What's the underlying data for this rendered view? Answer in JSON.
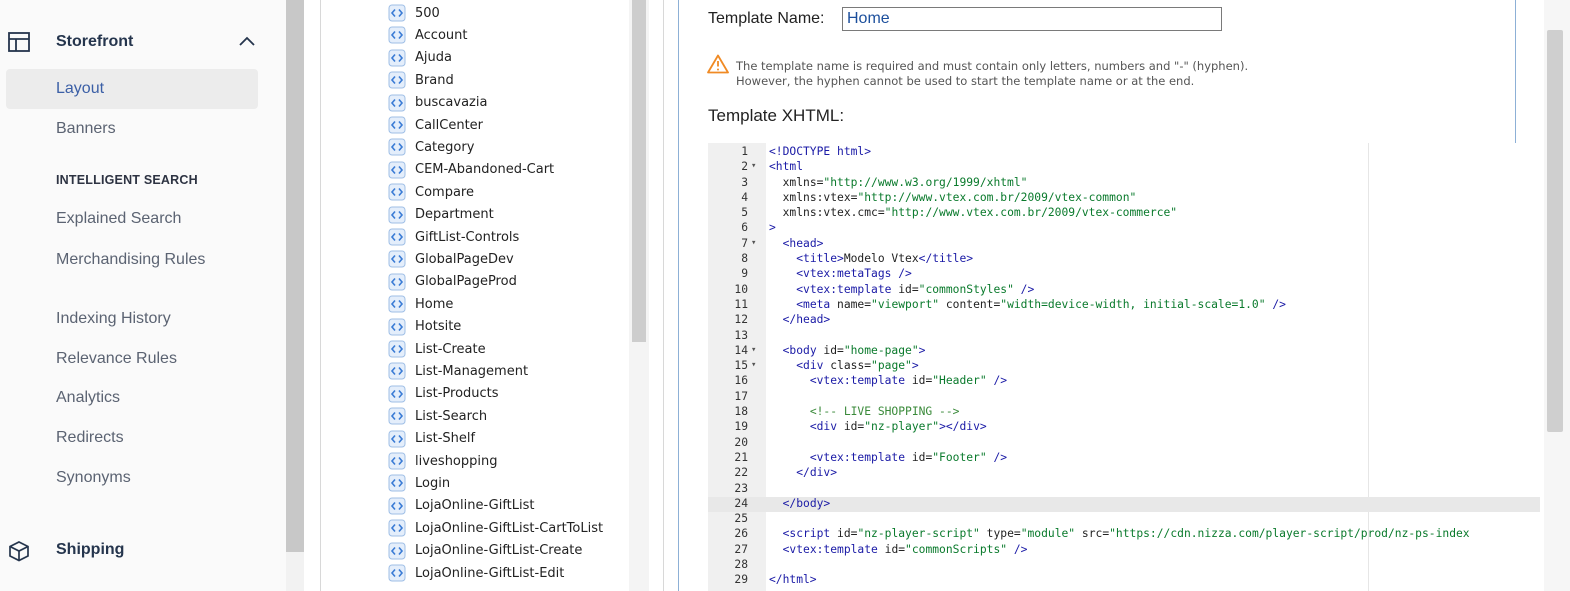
{
  "sidebar": {
    "storefront_label": "Storefront",
    "items": [
      {
        "label": "Layout"
      },
      {
        "label": "Banners"
      }
    ],
    "intelligent_search_heading": "INTELLIGENT SEARCH",
    "search_items": [
      {
        "label": "Explained Search"
      },
      {
        "label": "Merchandising Rules"
      },
      {
        "label": "Indexing History"
      },
      {
        "label": "Relevance Rules"
      },
      {
        "label": "Analytics"
      },
      {
        "label": "Redirects"
      },
      {
        "label": "Synonyms"
      }
    ],
    "shipping_label": "Shipping"
  },
  "templates": [
    "500",
    "Account",
    "Ajuda",
    "Brand",
    "buscavazia",
    "CallCenter",
    "Category",
    "CEM-Abandoned-Cart",
    "Compare",
    "Department",
    "GiftList-Controls",
    "GlobalPageDev",
    "GlobalPageProd",
    "Home",
    "Hotsite",
    "List-Create",
    "List-Management",
    "List-Products",
    "List-Search",
    "List-Shelf",
    "liveshopping",
    "Login",
    "LojaOnline-GiftList",
    "LojaOnline-GiftList-CartToList",
    "LojaOnline-GiftList-Create",
    "LojaOnline-GiftList-Edit"
  ],
  "editor": {
    "template_name_label": "Template Name:",
    "template_name_value": "Home",
    "warning_line1": "The template name is required and must contain only letters, numbers and \"-\" (hyphen).",
    "warning_line2": "However, the hyphen cannot be used to start the template name or at the end.",
    "xhtml_label": "Template XHTML:",
    "active_line": 24,
    "code": [
      {
        "n": "1",
        "f": "",
        "segs": [
          [
            "tag",
            "<!DOCTYPE html>"
          ]
        ]
      },
      {
        "n": "2",
        "f": "▾",
        "segs": [
          [
            "tag",
            "<html"
          ]
        ]
      },
      {
        "n": "3",
        "f": "",
        "segs": [
          [
            "txt",
            "  "
          ],
          [
            "attr",
            "xmlns="
          ],
          [
            "str",
            "\"http://www.w3.org/1999/xhtml\""
          ]
        ]
      },
      {
        "n": "4",
        "f": "",
        "segs": [
          [
            "txt",
            "  "
          ],
          [
            "attr",
            "xmlns:vtex="
          ],
          [
            "str",
            "\"http://www.vtex.com.br/2009/vtex-common\""
          ]
        ]
      },
      {
        "n": "5",
        "f": "",
        "segs": [
          [
            "txt",
            "  "
          ],
          [
            "attr",
            "xmlns:vtex.cmc="
          ],
          [
            "str",
            "\"http://www.vtex.com.br/2009/vtex-commerce\""
          ]
        ]
      },
      {
        "n": "6",
        "f": "",
        "segs": [
          [
            "tag",
            ">"
          ]
        ]
      },
      {
        "n": "7",
        "f": "▾",
        "segs": [
          [
            "txt",
            "  "
          ],
          [
            "tag",
            "<head>"
          ]
        ]
      },
      {
        "n": "8",
        "f": "",
        "segs": [
          [
            "txt",
            "    "
          ],
          [
            "tag",
            "<title>"
          ],
          [
            "txt",
            "Modelo Vtex"
          ],
          [
            "tag",
            "</title>"
          ]
        ]
      },
      {
        "n": "9",
        "f": "",
        "segs": [
          [
            "txt",
            "    "
          ],
          [
            "tag",
            "<vtex:metaTags />"
          ]
        ]
      },
      {
        "n": "10",
        "f": "",
        "segs": [
          [
            "txt",
            "    "
          ],
          [
            "tag",
            "<vtex:template "
          ],
          [
            "attr",
            "id="
          ],
          [
            "str",
            "\"commonStyles\""
          ],
          [
            "tag",
            " />"
          ]
        ]
      },
      {
        "n": "11",
        "f": "",
        "segs": [
          [
            "txt",
            "    "
          ],
          [
            "tag",
            "<meta "
          ],
          [
            "attr",
            "name="
          ],
          [
            "str",
            "\"viewport\""
          ],
          [
            "attr",
            " content="
          ],
          [
            "str",
            "\"width=device-width, initial-scale=1.0\""
          ],
          [
            "tag",
            " />"
          ]
        ]
      },
      {
        "n": "12",
        "f": "",
        "segs": [
          [
            "txt",
            "  "
          ],
          [
            "tag",
            "</head>"
          ]
        ]
      },
      {
        "n": "13",
        "f": "",
        "segs": []
      },
      {
        "n": "14",
        "f": "▾",
        "segs": [
          [
            "txt",
            "  "
          ],
          [
            "tag",
            "<body "
          ],
          [
            "attr",
            "id="
          ],
          [
            "str",
            "\"home-page\""
          ],
          [
            "tag",
            ">"
          ]
        ]
      },
      {
        "n": "15",
        "f": "▾",
        "segs": [
          [
            "txt",
            "    "
          ],
          [
            "tag",
            "<div "
          ],
          [
            "attr",
            "class="
          ],
          [
            "str",
            "\"page\""
          ],
          [
            "tag",
            ">"
          ]
        ]
      },
      {
        "n": "16",
        "f": "",
        "segs": [
          [
            "txt",
            "      "
          ],
          [
            "tag",
            "<vtex:template "
          ],
          [
            "attr",
            "id="
          ],
          [
            "str",
            "\"Header\""
          ],
          [
            "tag",
            " />"
          ]
        ]
      },
      {
        "n": "17",
        "f": "",
        "segs": []
      },
      {
        "n": "18",
        "f": "",
        "segs": [
          [
            "txt",
            "      "
          ],
          [
            "cmt",
            "<!-- LIVE SHOPPING -->"
          ]
        ]
      },
      {
        "n": "19",
        "f": "",
        "segs": [
          [
            "txt",
            "      "
          ],
          [
            "tag",
            "<div "
          ],
          [
            "attr",
            "id="
          ],
          [
            "str",
            "\"nz-player\""
          ],
          [
            "tag",
            "></div>"
          ]
        ]
      },
      {
        "n": "20",
        "f": "",
        "segs": []
      },
      {
        "n": "21",
        "f": "",
        "segs": [
          [
            "txt",
            "      "
          ],
          [
            "tag",
            "<vtex:template "
          ],
          [
            "attr",
            "id="
          ],
          [
            "str",
            "\"Footer\""
          ],
          [
            "tag",
            " />"
          ]
        ]
      },
      {
        "n": "22",
        "f": "",
        "segs": [
          [
            "txt",
            "    "
          ],
          [
            "tag",
            "</div>"
          ]
        ]
      },
      {
        "n": "23",
        "f": "",
        "segs": []
      },
      {
        "n": "24",
        "f": "",
        "segs": [
          [
            "txt",
            "  "
          ],
          [
            "tag",
            "</body>"
          ]
        ]
      },
      {
        "n": "25",
        "f": "",
        "segs": []
      },
      {
        "n": "26",
        "f": "",
        "segs": [
          [
            "txt",
            "  "
          ],
          [
            "tag",
            "<script "
          ],
          [
            "attr",
            "id="
          ],
          [
            "str",
            "\"nz-player-script\""
          ],
          [
            "attr",
            " type="
          ],
          [
            "str",
            "\"module\""
          ],
          [
            "attr",
            " src="
          ],
          [
            "str",
            "\"https://cdn.nizza.com/player-script/prod/nz-ps-index"
          ]
        ]
      },
      {
        "n": "27",
        "f": "",
        "segs": [
          [
            "txt",
            "  "
          ],
          [
            "tag",
            "<vtex:template "
          ],
          [
            "attr",
            "id="
          ],
          [
            "str",
            "\"commonScripts\""
          ],
          [
            "tag",
            " />"
          ]
        ]
      },
      {
        "n": "28",
        "f": "",
        "segs": []
      },
      {
        "n": "29",
        "f": "",
        "segs": [
          [
            "tag",
            "</html>"
          ]
        ]
      }
    ]
  },
  "icons": {
    "storefront": "layout-icon",
    "collapse": "chevron-up-icon",
    "shipping": "box-icon",
    "template": "code-file-icon",
    "warning": "warning-icon"
  },
  "colors": {
    "accent": "#3b5fa6",
    "warning": "#f08a24",
    "template_icon": "#3a7bd5"
  }
}
